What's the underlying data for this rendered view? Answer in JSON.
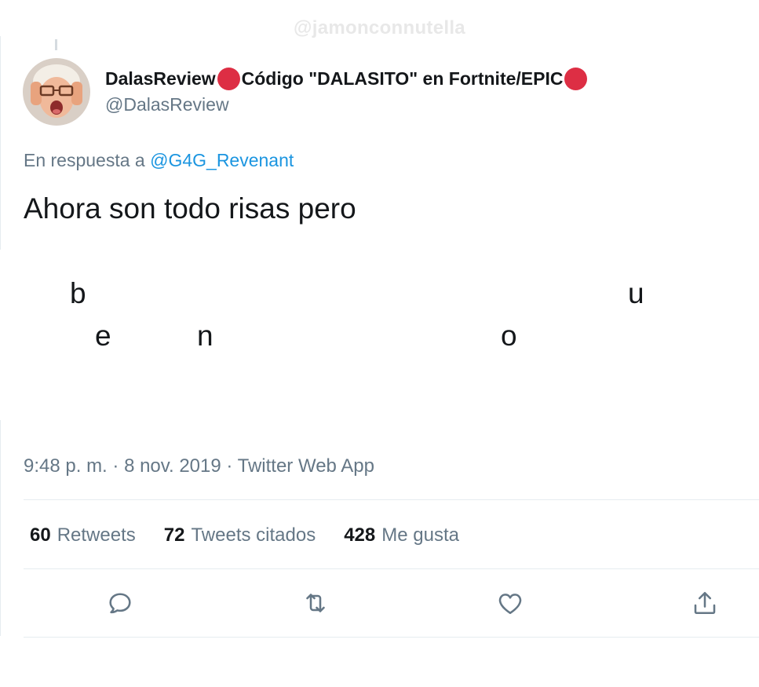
{
  "watermark": "@jamonconnutella",
  "tweet": {
    "display_name_part1": "DalasReview ",
    "display_name_part2": "Código \"DALASITO\" en Fortnite/EPIC",
    "handle": "@DalasReview",
    "reply_prefix": "En respuesta a ",
    "reply_mention": "@G4G_Revenant",
    "text": "Ahora son todo risas pero",
    "scattered_letters": [
      "b",
      "e",
      "n",
      "u",
      "o"
    ],
    "time": "9:48 p. m.",
    "separator": " · ",
    "date": "8 nov. 2019",
    "source": "Twitter Web App"
  },
  "stats": {
    "retweets_count": "60",
    "retweets_label": "Retweets",
    "quotes_count": "72",
    "quotes_label": "Tweets citados",
    "likes_count": "428",
    "likes_label": "Me gusta"
  },
  "actions": {
    "reply_icon": "reply-icon",
    "retweet_icon": "retweet-icon",
    "like_icon": "heart-icon",
    "share_icon": "share-icon"
  },
  "colors": {
    "link": "#1b95e0",
    "secondary_text": "#657786",
    "emoji_red": "#dd2e44"
  }
}
